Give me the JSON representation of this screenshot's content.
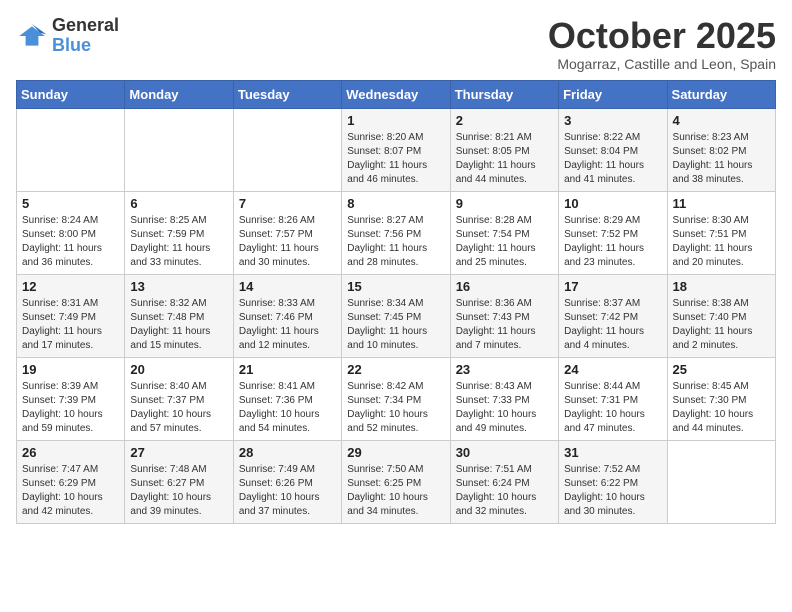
{
  "header": {
    "logo_line1": "General",
    "logo_line2": "Blue",
    "month_title": "October 2025",
    "location": "Mogarraz, Castille and Leon, Spain"
  },
  "weekdays": [
    "Sunday",
    "Monday",
    "Tuesday",
    "Wednesday",
    "Thursday",
    "Friday",
    "Saturday"
  ],
  "weeks": [
    [
      {
        "day": "",
        "info": ""
      },
      {
        "day": "",
        "info": ""
      },
      {
        "day": "",
        "info": ""
      },
      {
        "day": "1",
        "info": "Sunrise: 8:20 AM\nSunset: 8:07 PM\nDaylight: 11 hours and 46 minutes."
      },
      {
        "day": "2",
        "info": "Sunrise: 8:21 AM\nSunset: 8:05 PM\nDaylight: 11 hours and 44 minutes."
      },
      {
        "day": "3",
        "info": "Sunrise: 8:22 AM\nSunset: 8:04 PM\nDaylight: 11 hours and 41 minutes."
      },
      {
        "day": "4",
        "info": "Sunrise: 8:23 AM\nSunset: 8:02 PM\nDaylight: 11 hours and 38 minutes."
      }
    ],
    [
      {
        "day": "5",
        "info": "Sunrise: 8:24 AM\nSunset: 8:00 PM\nDaylight: 11 hours and 36 minutes."
      },
      {
        "day": "6",
        "info": "Sunrise: 8:25 AM\nSunset: 7:59 PM\nDaylight: 11 hours and 33 minutes."
      },
      {
        "day": "7",
        "info": "Sunrise: 8:26 AM\nSunset: 7:57 PM\nDaylight: 11 hours and 30 minutes."
      },
      {
        "day": "8",
        "info": "Sunrise: 8:27 AM\nSunset: 7:56 PM\nDaylight: 11 hours and 28 minutes."
      },
      {
        "day": "9",
        "info": "Sunrise: 8:28 AM\nSunset: 7:54 PM\nDaylight: 11 hours and 25 minutes."
      },
      {
        "day": "10",
        "info": "Sunrise: 8:29 AM\nSunset: 7:52 PM\nDaylight: 11 hours and 23 minutes."
      },
      {
        "day": "11",
        "info": "Sunrise: 8:30 AM\nSunset: 7:51 PM\nDaylight: 11 hours and 20 minutes."
      }
    ],
    [
      {
        "day": "12",
        "info": "Sunrise: 8:31 AM\nSunset: 7:49 PM\nDaylight: 11 hours and 17 minutes."
      },
      {
        "day": "13",
        "info": "Sunrise: 8:32 AM\nSunset: 7:48 PM\nDaylight: 11 hours and 15 minutes."
      },
      {
        "day": "14",
        "info": "Sunrise: 8:33 AM\nSunset: 7:46 PM\nDaylight: 11 hours and 12 minutes."
      },
      {
        "day": "15",
        "info": "Sunrise: 8:34 AM\nSunset: 7:45 PM\nDaylight: 11 hours and 10 minutes."
      },
      {
        "day": "16",
        "info": "Sunrise: 8:36 AM\nSunset: 7:43 PM\nDaylight: 11 hours and 7 minutes."
      },
      {
        "day": "17",
        "info": "Sunrise: 8:37 AM\nSunset: 7:42 PM\nDaylight: 11 hours and 4 minutes."
      },
      {
        "day": "18",
        "info": "Sunrise: 8:38 AM\nSunset: 7:40 PM\nDaylight: 11 hours and 2 minutes."
      }
    ],
    [
      {
        "day": "19",
        "info": "Sunrise: 8:39 AM\nSunset: 7:39 PM\nDaylight: 10 hours and 59 minutes."
      },
      {
        "day": "20",
        "info": "Sunrise: 8:40 AM\nSunset: 7:37 PM\nDaylight: 10 hours and 57 minutes."
      },
      {
        "day": "21",
        "info": "Sunrise: 8:41 AM\nSunset: 7:36 PM\nDaylight: 10 hours and 54 minutes."
      },
      {
        "day": "22",
        "info": "Sunrise: 8:42 AM\nSunset: 7:34 PM\nDaylight: 10 hours and 52 minutes."
      },
      {
        "day": "23",
        "info": "Sunrise: 8:43 AM\nSunset: 7:33 PM\nDaylight: 10 hours and 49 minutes."
      },
      {
        "day": "24",
        "info": "Sunrise: 8:44 AM\nSunset: 7:31 PM\nDaylight: 10 hours and 47 minutes."
      },
      {
        "day": "25",
        "info": "Sunrise: 8:45 AM\nSunset: 7:30 PM\nDaylight: 10 hours and 44 minutes."
      }
    ],
    [
      {
        "day": "26",
        "info": "Sunrise: 7:47 AM\nSunset: 6:29 PM\nDaylight: 10 hours and 42 minutes."
      },
      {
        "day": "27",
        "info": "Sunrise: 7:48 AM\nSunset: 6:27 PM\nDaylight: 10 hours and 39 minutes."
      },
      {
        "day": "28",
        "info": "Sunrise: 7:49 AM\nSunset: 6:26 PM\nDaylight: 10 hours and 37 minutes."
      },
      {
        "day": "29",
        "info": "Sunrise: 7:50 AM\nSunset: 6:25 PM\nDaylight: 10 hours and 34 minutes."
      },
      {
        "day": "30",
        "info": "Sunrise: 7:51 AM\nSunset: 6:24 PM\nDaylight: 10 hours and 32 minutes."
      },
      {
        "day": "31",
        "info": "Sunrise: 7:52 AM\nSunset: 6:22 PM\nDaylight: 10 hours and 30 minutes."
      },
      {
        "day": "",
        "info": ""
      }
    ]
  ]
}
